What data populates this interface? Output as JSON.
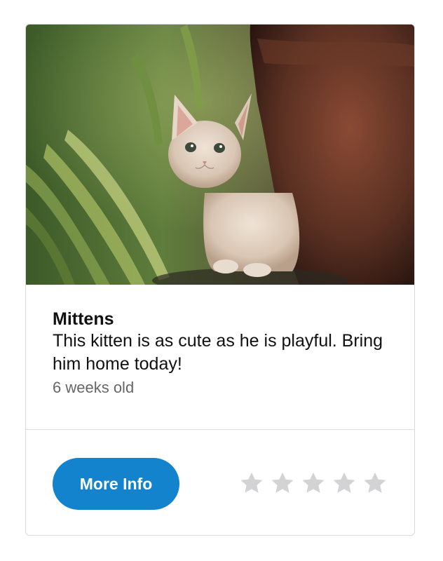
{
  "card": {
    "image": {
      "alt": "Kitten photo",
      "subject": "kitten-photo"
    },
    "title": "Mittens",
    "description": "This kitten is as cute as he is playful. Bring him home today!",
    "age": "6 weeks old",
    "button": {
      "label": "More Info",
      "color": "#1283cc"
    },
    "rating": {
      "value": 0,
      "max": 5,
      "empty_color": "#d3d3d6",
      "icon": "star-icon"
    }
  }
}
